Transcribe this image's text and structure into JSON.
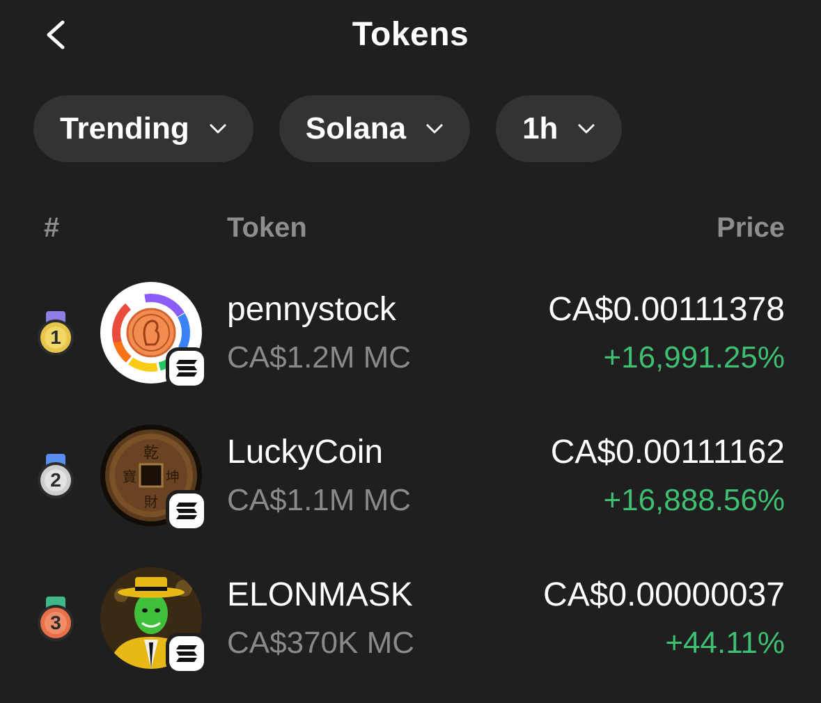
{
  "header": {
    "title": "Tokens"
  },
  "filters": [
    {
      "label": "Trending"
    },
    {
      "label": "Solana"
    },
    {
      "label": "1h"
    }
  ],
  "table": {
    "col_rank": "#",
    "col_token": "Token",
    "col_price": "Price"
  },
  "tokens": [
    {
      "rank": "1",
      "name": "pennystock",
      "market_cap": "CA$1.2M MC",
      "price": "CA$0.00111378",
      "change": "+16,991.25%",
      "chain_icon": "solana-icon",
      "medal_color": "#e7c54a"
    },
    {
      "rank": "2",
      "name": "LuckyCoin",
      "market_cap": "CA$1.1M MC",
      "price": "CA$0.00111162",
      "change": "+16,888.56%",
      "chain_icon": "solana-icon",
      "medal_color": "#cfcfcf"
    },
    {
      "rank": "3",
      "name": "ELONMASK",
      "market_cap": "CA$370K MC",
      "price": "CA$0.00000037",
      "change": "+44.11%",
      "chain_icon": "solana-icon",
      "medal_color": "#e8714a"
    }
  ],
  "colors": {
    "positive": "#3fbf72",
    "background": "#1f1f1f",
    "pill": "#333333"
  }
}
